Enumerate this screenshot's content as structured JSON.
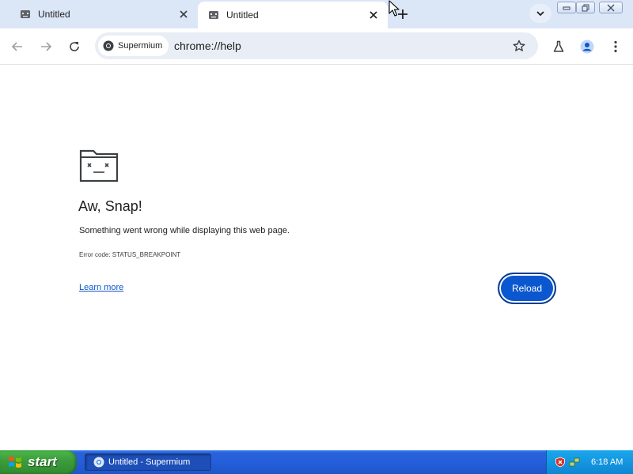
{
  "browser": {
    "tabs": [
      {
        "title": "Untitled",
        "active": false
      },
      {
        "title": "Untitled",
        "active": true
      }
    ],
    "new_tab_icon": "plus-icon",
    "tab_search_icon": "chevron-down-icon",
    "window_controls": [
      "minimize-icon",
      "restore-icon",
      "close-icon"
    ],
    "omnibox": {
      "chip_label": "Supermium",
      "url": "chrome://help"
    },
    "toolbar_icons": [
      "back-arrow-icon",
      "forward-arrow-icon",
      "reload-icon",
      "star-icon",
      "flask-icon",
      "profile-icon",
      "kebab-menu-icon"
    ]
  },
  "page": {
    "icon": "sad-tab-icon",
    "headline": "Aw, Snap!",
    "message": "Something went wrong while displaying this web page.",
    "error_code": "Error code: STATUS_BREAKPOINT",
    "learn_more": "Learn more",
    "reload_label": "Reload"
  },
  "taskbar": {
    "start_label": "start",
    "items": [
      {
        "label": "Untitled - Supermium"
      }
    ],
    "clock": "6:18 AM"
  },
  "colors": {
    "tabstrip": "#dbe6f7",
    "accent": "#0b57d0",
    "taskbar": "#245edb",
    "start": "#3c9b3c",
    "tray": "#0f86d3"
  }
}
